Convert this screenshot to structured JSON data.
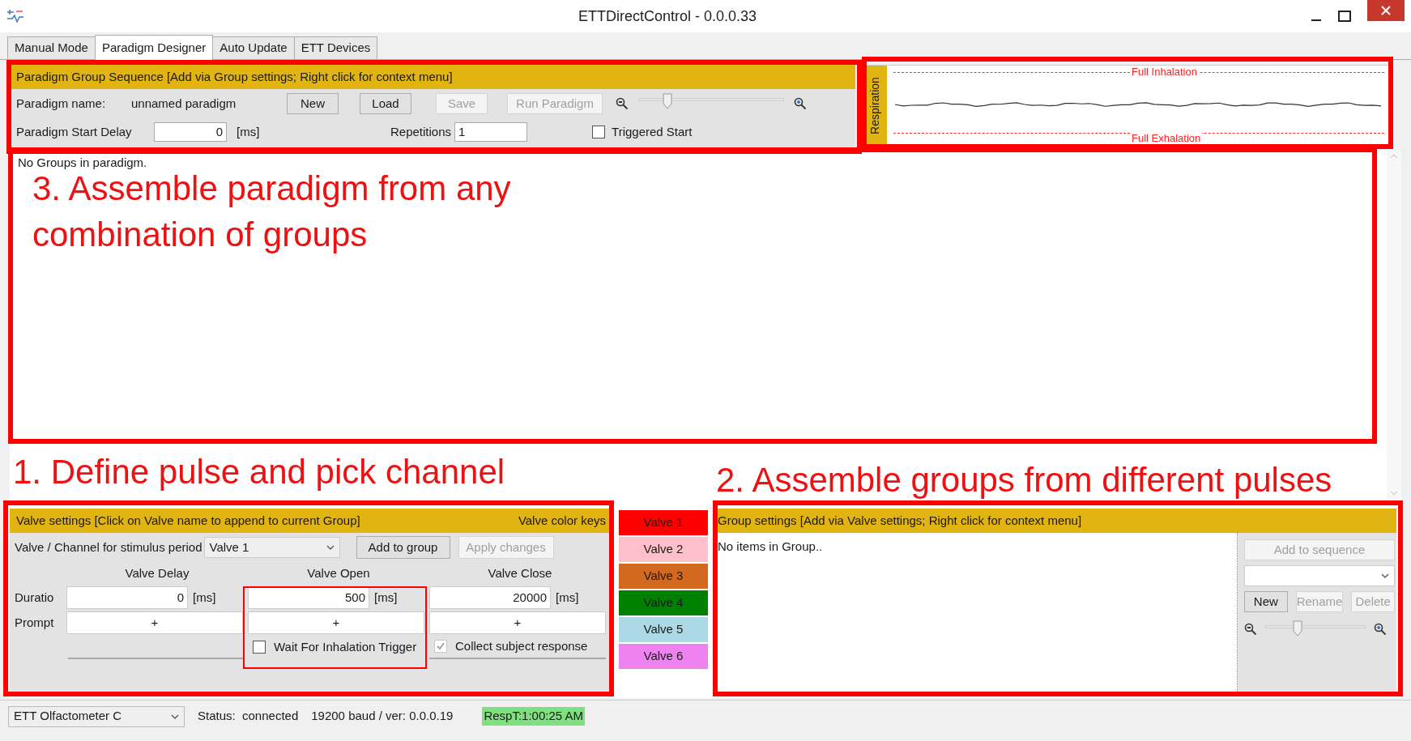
{
  "window": {
    "title": "ETTDirectControl - 0.0.0.33"
  },
  "tabs": [
    {
      "label": "Manual Mode",
      "selected": false
    },
    {
      "label": "Paradigm Designer",
      "selected": true
    },
    {
      "label": "Auto Update",
      "selected": false
    },
    {
      "label": "ETT Devices",
      "selected": false
    }
  ],
  "paradigm": {
    "header": "Paradigm Group Sequence [Add via Group settings; Right click for context menu]",
    "name_label": "Paradigm name:",
    "name_value": "unnamed paradigm",
    "buttons": [
      {
        "label": "New",
        "disabled": false
      },
      {
        "label": "Load",
        "disabled": false
      },
      {
        "label": "Save",
        "disabled": true
      },
      {
        "label": "Run Paradigm",
        "disabled": true
      }
    ],
    "zoom": {
      "level": 0.18
    },
    "start_delay_label": "Paradigm Start Delay",
    "start_delay_value": "0",
    "start_delay_unit": "[ms]",
    "repetitions_label": "Repetitions",
    "repetitions_value": "1",
    "triggered_start": {
      "label": "Triggered Start",
      "checked": false
    }
  },
  "respiration": {
    "label": "Respiration",
    "top_label": "Full Inhalation",
    "bottom_label": "Full Exhalation"
  },
  "sequence": {
    "empty_text": "No Groups in paradigm."
  },
  "valve_settings": {
    "header": "Valve settings [Click on Valve name to append to current Group]",
    "keys_title": "Valve color keys",
    "channel_label": "Valve / Channel for stimulus period",
    "channel_value": "Valve 1",
    "buttons": [
      {
        "label": "Add to group",
        "disabled": false
      },
      {
        "label": "Apply changes",
        "disabled": true
      }
    ],
    "columns": [
      "Valve Delay",
      "Valve Open",
      "Valve Close"
    ],
    "duration_label": "Duratio",
    "durations": [
      {
        "value": "0",
        "unit": "[ms]"
      },
      {
        "value": "500",
        "unit": "[ms]"
      },
      {
        "value": "20000",
        "unit": "[ms]"
      }
    ],
    "prompt_label": "Prompt",
    "prompts": [
      "+",
      "+",
      "+"
    ],
    "checkboxes": [
      {
        "label": "Wait For Inhalation Trigger",
        "checked": false,
        "disabled": false
      },
      {
        "label": "Collect subject response",
        "checked": true,
        "disabled": true
      }
    ]
  },
  "valve_keys": [
    {
      "label": "Valve 1",
      "color": "#ff0000"
    },
    {
      "label": "Valve 2",
      "color": "#ffc0cb"
    },
    {
      "label": "Valve 3",
      "color": "#d2691e"
    },
    {
      "label": "Valve 4",
      "color": "#008000"
    },
    {
      "label": "Valve 5",
      "color": "#add8e6"
    },
    {
      "label": "Valve 6",
      "color": "#ee82ee"
    }
  ],
  "group_settings": {
    "header": "Group settings [Add via Valve settings; Right click for context menu]",
    "empty_text": "No items in Group..",
    "add_to_sequence": {
      "label": "Add to sequence",
      "disabled": true
    },
    "buttons": [
      {
        "label": "New",
        "disabled": false
      },
      {
        "label": "Rename",
        "disabled": true
      },
      {
        "label": "Delete",
        "disabled": true
      }
    ],
    "zoom": {
      "level": 0.3
    }
  },
  "status_bar": {
    "device": "ETT Olfactometer C",
    "status": "Status:  connected",
    "connection": "19200 baud / ver: 0.0.0.19",
    "resp_time": "RespT:1:00:25 AM"
  },
  "annotations": {
    "sequence_note": "3. Assemble paradigm from any combination of groups",
    "valve_note": "1. Define pulse and pick channel",
    "group_note": "2. Assemble groups from different pulses"
  }
}
